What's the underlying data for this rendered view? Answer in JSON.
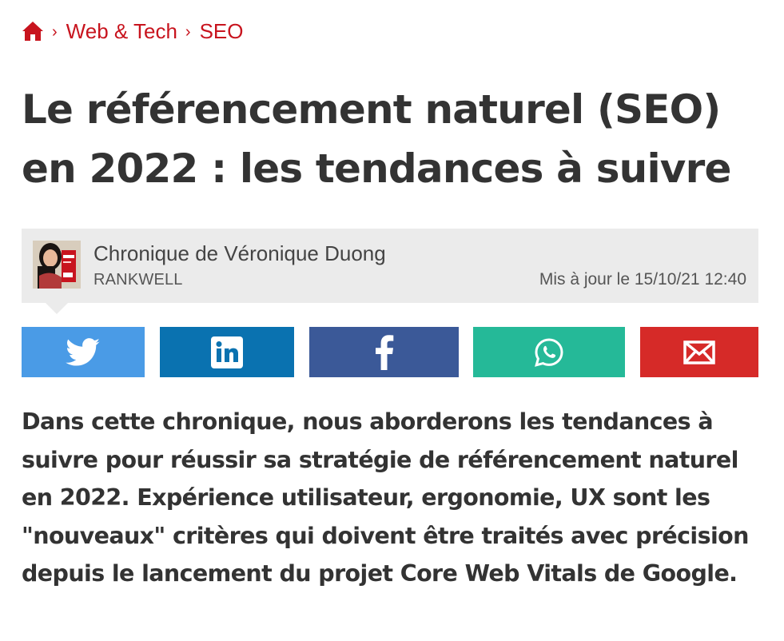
{
  "breadcrumb": {
    "home_icon": "home-icon",
    "items": [
      "Web & Tech",
      "SEO"
    ],
    "separator": "›"
  },
  "article": {
    "title_line1": "Le référencement naturel (SEO)",
    "title_line2": "en 2022 : les tendances à suivre",
    "intro": "Dans cette chronique, nous aborderons les tendances à suivre pour réussir sa stratégie de référencement naturel en 2022. Expérience utilisateur, ergonomie, UX sont les \"nouveaux\" critères qui doivent être traités avec précision depuis le lancement du projet Core Web Vitals de Google."
  },
  "author": {
    "name": "Chronique de Véronique Duong",
    "company": "RANKWELL",
    "updated": "Mis à jour le 15/10/21 12:40"
  },
  "share": [
    {
      "network": "twitter",
      "icon": "twitter-icon",
      "color": "#4a9be6"
    },
    {
      "network": "linkedin",
      "icon": "linkedin-icon",
      "color": "#0a72b0"
    },
    {
      "network": "facebook",
      "icon": "facebook-icon",
      "color": "#3b5998"
    },
    {
      "network": "whatsapp",
      "icon": "whatsapp-icon",
      "color": "#25b998"
    },
    {
      "network": "email",
      "icon": "email-icon",
      "color": "#d62a28"
    }
  ],
  "colors": {
    "accent": "#c8141e",
    "text": "#333333",
    "author_bg": "#ebebeb"
  }
}
